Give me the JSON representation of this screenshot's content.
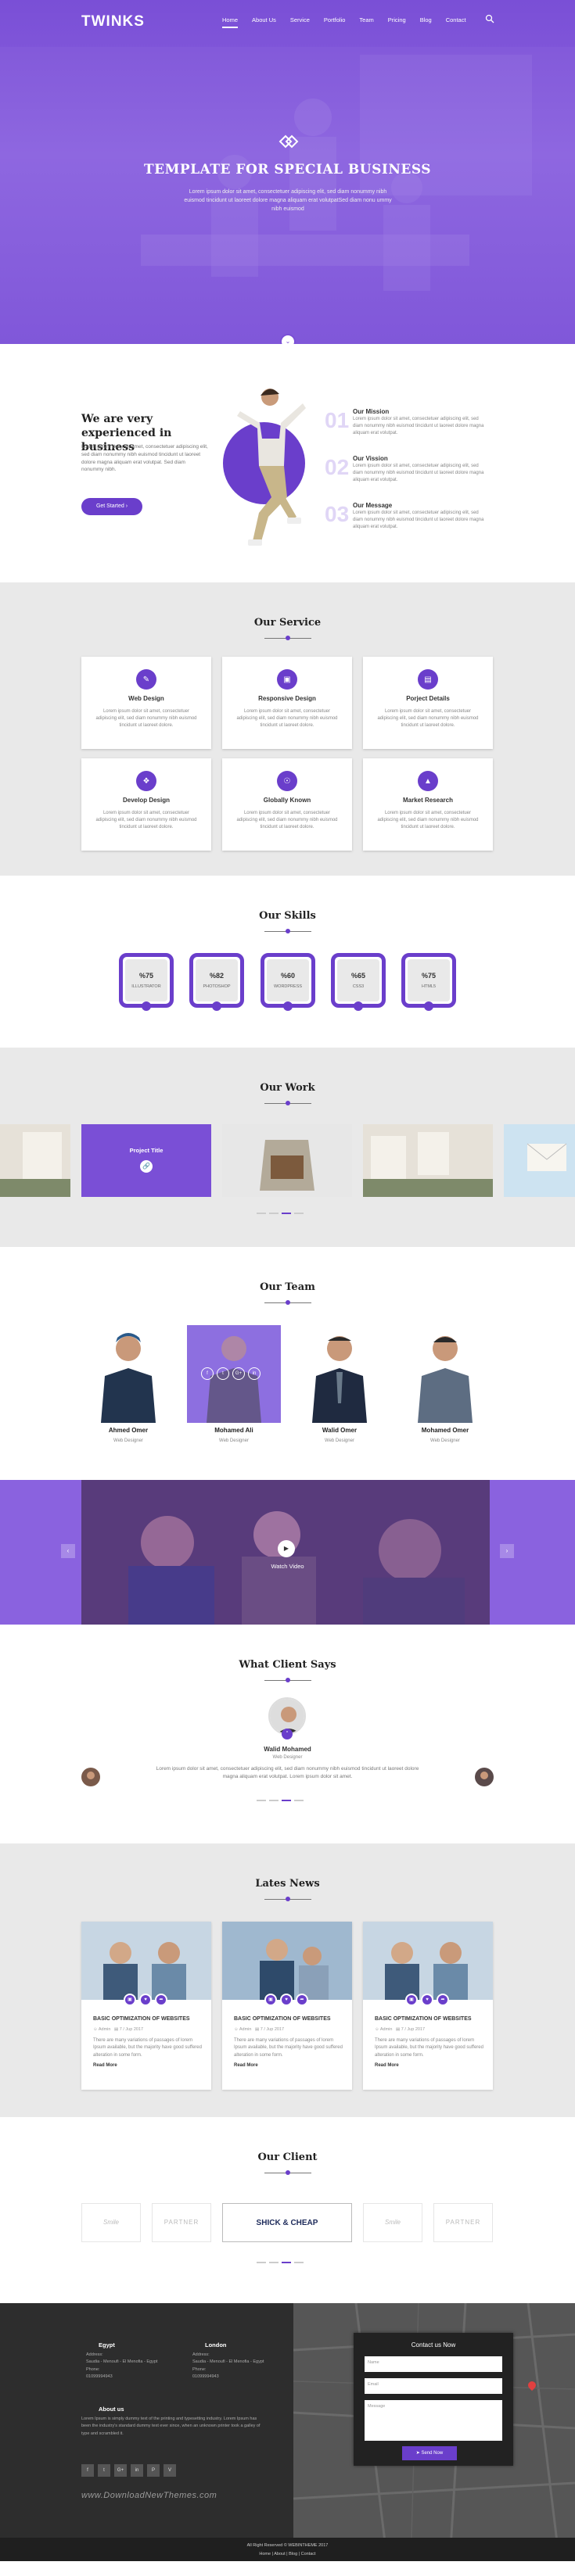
{
  "brand": "TWINKS",
  "nav": [
    "Home",
    "About Us",
    "Service",
    "Portfolio",
    "Team",
    "Pricing",
    "Blog",
    "Contact"
  ],
  "hero": {
    "title": "TEMPLATE FOR SPECIAL BUSINESS",
    "subtitle": "Lorem ipsum dolor sit amet, consectetuer adipiscing elit, sed diam nonummy nibh euismod tincidunt ut laoreet dolore magna aliquam erat volutpatSed diam nonu ummy nibh euismod"
  },
  "about": {
    "title": "We are very experienced in business",
    "text": "Lorem ipsum dolor sit amet, consectetuer adipiscing elit, sed diam nonummy nibh euismod tincidunt ut laoreet dolore magna aliquam erat volutpat. Sed diam nonummy nibh.",
    "button": "Get Started",
    "items": [
      {
        "num": "01",
        "title": "Our Mission",
        "text": "Lorem ipsum dolor sit amet, consectetuer adipiscing elit, sed diam nonummy nibh euismod tincidunt ut laoreet dolore magna aliquam erat volutpat."
      },
      {
        "num": "02",
        "title": "Our Vission",
        "text": "Lorem ipsum dolor sit amet, consectetuer adipiscing elit, sed diam nonummy nibh euismod tincidunt ut laoreet dolore magna aliquam erat volutpat."
      },
      {
        "num": "03",
        "title": "Our Message",
        "text": "Lorem ipsum dolor sit amet, consectetuer adipiscing elit, sed diam nonummy nibh euismod tincidunt ut laoreet dolore magna aliquam erat volutpat."
      }
    ]
  },
  "services": {
    "title": "Our Service",
    "items": [
      {
        "title": "Web Design",
        "text": "Lorem ipsum dolor sit amet, consectetuer adipiscing elit, sed diam nonummy nibh euismod tincidunt ut laoreet dolore."
      },
      {
        "title": "Responsive Design",
        "text": "Lorem ipsum dolor sit amet, consectetuer adipiscing elit, sed diam nonummy nibh euismod tincidunt ut laoreet dolore."
      },
      {
        "title": "Porject Details",
        "text": "Lorem ipsum dolor sit amet, consectetuer adipiscing elit, sed diam nonummy nibh euismod tincidunt ut laoreet dolore."
      },
      {
        "title": "Develop Design",
        "text": "Lorem ipsum dolor sit amet, consectetuer adipiscing elit, sed diam nonummy nibh euismod tincidunt ut laoreet dolore."
      },
      {
        "title": "Globally Known",
        "text": "Lorem ipsum dolor sit amet, consectetuer adipiscing elit, sed diam nonummy nibh euismod tincidunt ut laoreet dolore."
      },
      {
        "title": "Market Research",
        "text": "Lorem ipsum dolor sit amet, consectetuer adipiscing elit, sed diam nonummy nibh euismod tincidunt ut laoreet dolore."
      }
    ]
  },
  "skills": {
    "title": "Our Skills",
    "items": [
      {
        "value": "%75",
        "name": "ILLUSTRATOR"
      },
      {
        "value": "%82",
        "name": "PHOTOSHOP"
      },
      {
        "value": "%60",
        "name": "WORDPRESS"
      },
      {
        "value": "%65",
        "name": "CSS3"
      },
      {
        "value": "%75",
        "name": "HTML5"
      }
    ]
  },
  "work": {
    "title": "Our Work",
    "active_label": "Project Title"
  },
  "team": {
    "title": "Our Team",
    "members": [
      {
        "name": "Ahmed Omer",
        "role": "Web Designer"
      },
      {
        "name": "Mohamed Ali",
        "role": "Web Designer"
      },
      {
        "name": "Walid Omer",
        "role": "Web Designer"
      },
      {
        "name": "Mohamed Omer",
        "role": "Web Designer"
      }
    ]
  },
  "video": {
    "label": "Watch Video"
  },
  "testimonial": {
    "title": "What Client Says",
    "name": "Walid Mohamed",
    "role": "Web Designer",
    "text": "Lorem ipsum dolor sit amet, consectetuer adipiscing elit, sed diam nonummy nibh euismod tincidunt ut laoreet dolore magna aliquam erat volutpat. Lorem ipsum dolor sit amet."
  },
  "news": {
    "title": "Lates News",
    "items": [
      {
        "title": "BASIC OPTIMIZATION OF WEBSITES",
        "author": "Admin",
        "date": "7 / Jup 2017",
        "text": "There are many variations of passages of lorem Ipsum available, but the majority have good suffered alteration in some form.",
        "more": "Read More"
      },
      {
        "title": "BASIC OPTIMIZATION OF WEBSITES",
        "author": "Admin",
        "date": "7 / Jup 2017",
        "text": "There are many variations of passages of lorem Ipsum available, but the majority have good suffered alteration in some form.",
        "more": "Read More"
      },
      {
        "title": "BASIC OPTIMIZATION OF WEBSITES",
        "author": "Admin",
        "date": "7 / Jup 2017",
        "text": "There are many variations of passages of lorem Ipsum available, but the majority have good suffered alteration in some form.",
        "more": "Read More"
      }
    ]
  },
  "clients": {
    "title": "Our Client",
    "logos": [
      "Smile",
      "PARTNER",
      "SHICK & CHEAP",
      "Smile",
      "PARTNER"
    ]
  },
  "footer": {
    "egypt": {
      "title": "Egypt",
      "address_label": "Address:",
      "address": "Saudia - Menoufi - El Menofia - Egypt",
      "phone_label": "Phone:",
      "phone": "01099994943"
    },
    "london": {
      "title": "London",
      "address_label": "Address:",
      "address": "Saudia - Menoufi - El Menofia - Egypt",
      "phone_label": "Phone:",
      "phone": "01099994943"
    },
    "about_title": "About us",
    "about_text": "Lorem Ipsum is simply dummy text of the printing and typesetting industry. Lorem Ipsum has been the industry's standard dummy text ever since, when an unknown printer took a galley of type and scrambled it.",
    "contact": {
      "title": "Contact us Now",
      "name": "Name",
      "email": "Email",
      "message": "Message",
      "send": "Send Now"
    },
    "social": [
      "f",
      "t",
      "G+",
      "in",
      "P",
      "V"
    ],
    "watermark": "www.DownloadNewThemes.com",
    "copyright": "All Right Reserved © WEBINTHEME 2017",
    "links": "Home | About | Blog | Contact"
  }
}
